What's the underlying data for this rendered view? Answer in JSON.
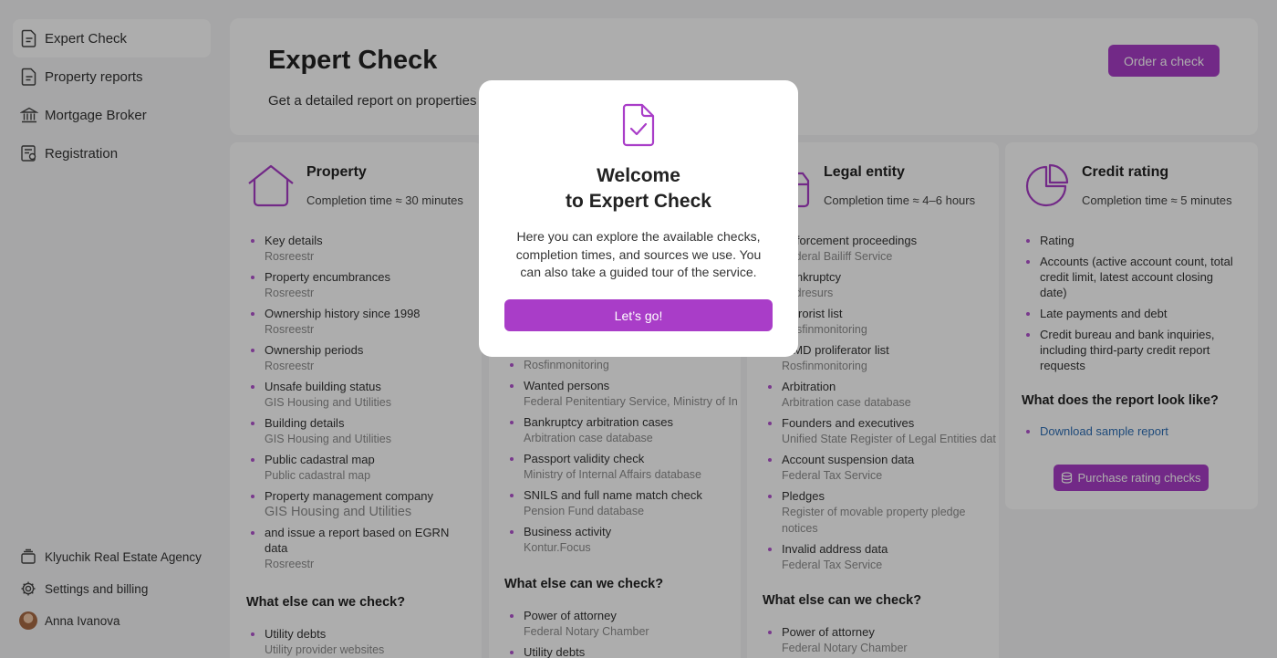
{
  "sidebar": {
    "items": [
      {
        "label": "Expert Check",
        "icon": "document-icon"
      },
      {
        "label": "Property reports",
        "icon": "document-icon"
      },
      {
        "label": "Mortgage Broker",
        "icon": "bank-icon"
      },
      {
        "label": "Registration",
        "icon": "registration-icon"
      }
    ],
    "agency": "Klyuchik Real Estate Agency",
    "settings": "Settings and billing",
    "user": "Anna Ivanova"
  },
  "header": {
    "title": "Expert Check",
    "subtitle": "Get a detailed report on properties",
    "order_button": "Order a check"
  },
  "cards": {
    "property": {
      "title": "Property",
      "time": "Completion time ≈ 30 minutes",
      "items": [
        {
          "name": "Key details",
          "source": "Rosreestr"
        },
        {
          "name": "Property encumbrances",
          "source": "Rosreestr"
        },
        {
          "name": "Ownership history since 1998",
          "source": "Rosreestr"
        },
        {
          "name": "Ownership periods",
          "source": "Rosreestr"
        },
        {
          "name": "Unsafe building status",
          "source": "GIS Housing and Utilities"
        },
        {
          "name": "Building details",
          "source": "GIS Housing and Utilities"
        },
        {
          "name": "Public cadastral map",
          "source": "Public cadastral map"
        },
        {
          "name": "Property management company",
          "source": "GIS Housing and Utilities"
        },
        {
          "name": "and issue a report based on EGRN data",
          "source": "Rosreestr"
        }
      ],
      "else_heading": "What else can we check?",
      "else_items": [
        {
          "name": "Utility debts",
          "source": "Utility provider websites"
        }
      ]
    },
    "individual": {
      "items": [
        {
          "source": "Rosfinmonitoring"
        },
        {
          "name": "Wanted persons",
          "source": "Federal Penitentiary Service, Ministry of In"
        },
        {
          "name": "Bankruptcy arbitration cases",
          "source": "Arbitration case database"
        },
        {
          "name": "Passport validity check",
          "source": "Ministry of Internal Affairs database"
        },
        {
          "name": "SNILS and full name match check",
          "source": "Pension Fund database"
        },
        {
          "name": "Business activity",
          "source": "Kontur.Focus"
        }
      ],
      "else_heading": "What else can we check?",
      "else_items": [
        {
          "name": "Power of attorney",
          "source": "Federal Notary Chamber"
        },
        {
          "name": "Utility debts"
        }
      ]
    },
    "legal": {
      "title": "Legal entity",
      "time": "Completion time ≈ 4–6 hours",
      "items": [
        {
          "name": "Enforcement proceedings",
          "source": "Federal Bailiff Service"
        },
        {
          "name": "Bankruptcy",
          "source": "Fedresurs"
        },
        {
          "name": "Terrorist list",
          "source": "Rosfinmonitoring"
        },
        {
          "name": "WMD proliferator list",
          "source": "Rosfinmonitoring"
        },
        {
          "name": "Arbitration",
          "source": "Arbitration case database"
        },
        {
          "name": "Founders and executives",
          "source": "Unified State Register of Legal Entities dat"
        },
        {
          "name": "Account suspension data",
          "source": "Federal Tax Service"
        },
        {
          "name": "Pledges",
          "source": "Register of movable property pledge notices"
        },
        {
          "name": "Invalid address data",
          "source": "Federal Tax Service"
        }
      ],
      "else_heading": "What else can we check?",
      "else_items": [
        {
          "name": "Power of attorney",
          "source": "Federal Notary Chamber"
        }
      ]
    },
    "credit": {
      "title": "Credit rating",
      "time": "Completion time ≈ 5 minutes",
      "items": [
        "Rating",
        "Accounts (active account count, total credit limit, latest account closing date)",
        "Late payments and debt",
        "Credit bureau and bank inquiries, including third-party credit report requests"
      ],
      "report_heading": "What does the report look like?",
      "download_link": "Download sample report",
      "purchase_button": "Purchase rating checks"
    }
  },
  "modal": {
    "title_line1": "Welcome",
    "title_line2": "to Expert Check",
    "text": "Here you can explore the available checks, completion times, and sources we use. You can also take a guided tour of the service.",
    "button": "Let’s go!"
  },
  "colors": {
    "accent": "#a93dc8",
    "bullet": "#b354d0",
    "link": "#2f6fb5",
    "overlay": "rgba(0,0,0,0.32)"
  }
}
